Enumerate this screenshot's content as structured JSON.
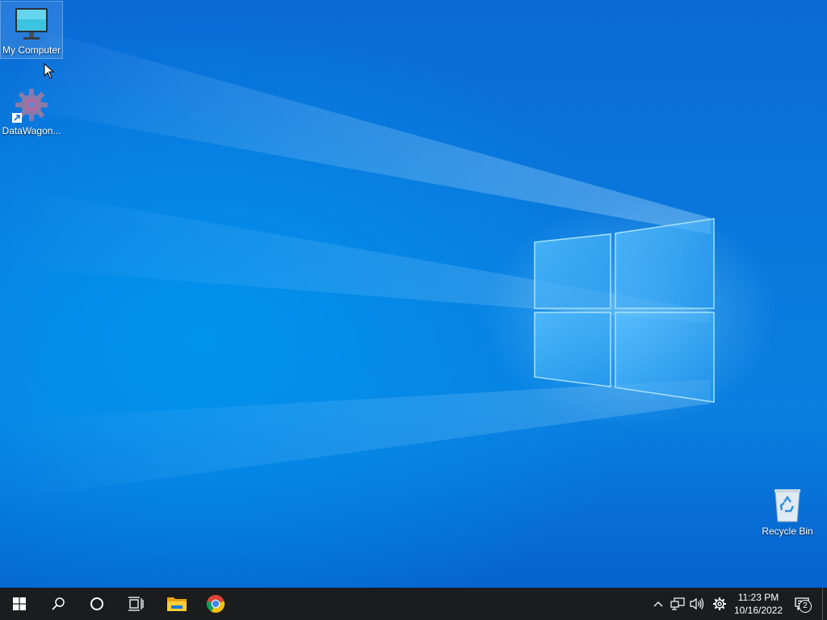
{
  "desktop": {
    "icons": [
      {
        "label": "My Computer",
        "icon": "monitor-icon"
      },
      {
        "label": "DataWagon...",
        "icon": "gear-app-icon"
      },
      {
        "label": "Recycle Bin",
        "icon": "recycle-bin-icon"
      }
    ],
    "wallpaper": "windows-10-hero"
  },
  "taskbar": {
    "start_icon": "windows-logo-icon",
    "search_icon": "search-icon",
    "cortana_icon": "cortana-circle-icon",
    "taskview_icon": "task-view-icon",
    "pinned": [
      {
        "name": "File Explorer",
        "icon": "folder-icon"
      },
      {
        "name": "Google Chrome",
        "icon": "chrome-icon"
      }
    ],
    "tray": {
      "chevron_icon": "chevron-up-icon",
      "network_icon": "network-icon",
      "volume_icon": "volume-icon",
      "settings_icon": "gear-icon"
    },
    "clock": {
      "time": "11:23 PM",
      "date": "10/16/2022"
    },
    "notifications": {
      "count": "2",
      "icon": "action-center-icon"
    }
  },
  "colors": {
    "taskbar_bg": "#1b1c1e",
    "wallpaper_blue": "#0a78dc",
    "accent": "#0078d7"
  }
}
